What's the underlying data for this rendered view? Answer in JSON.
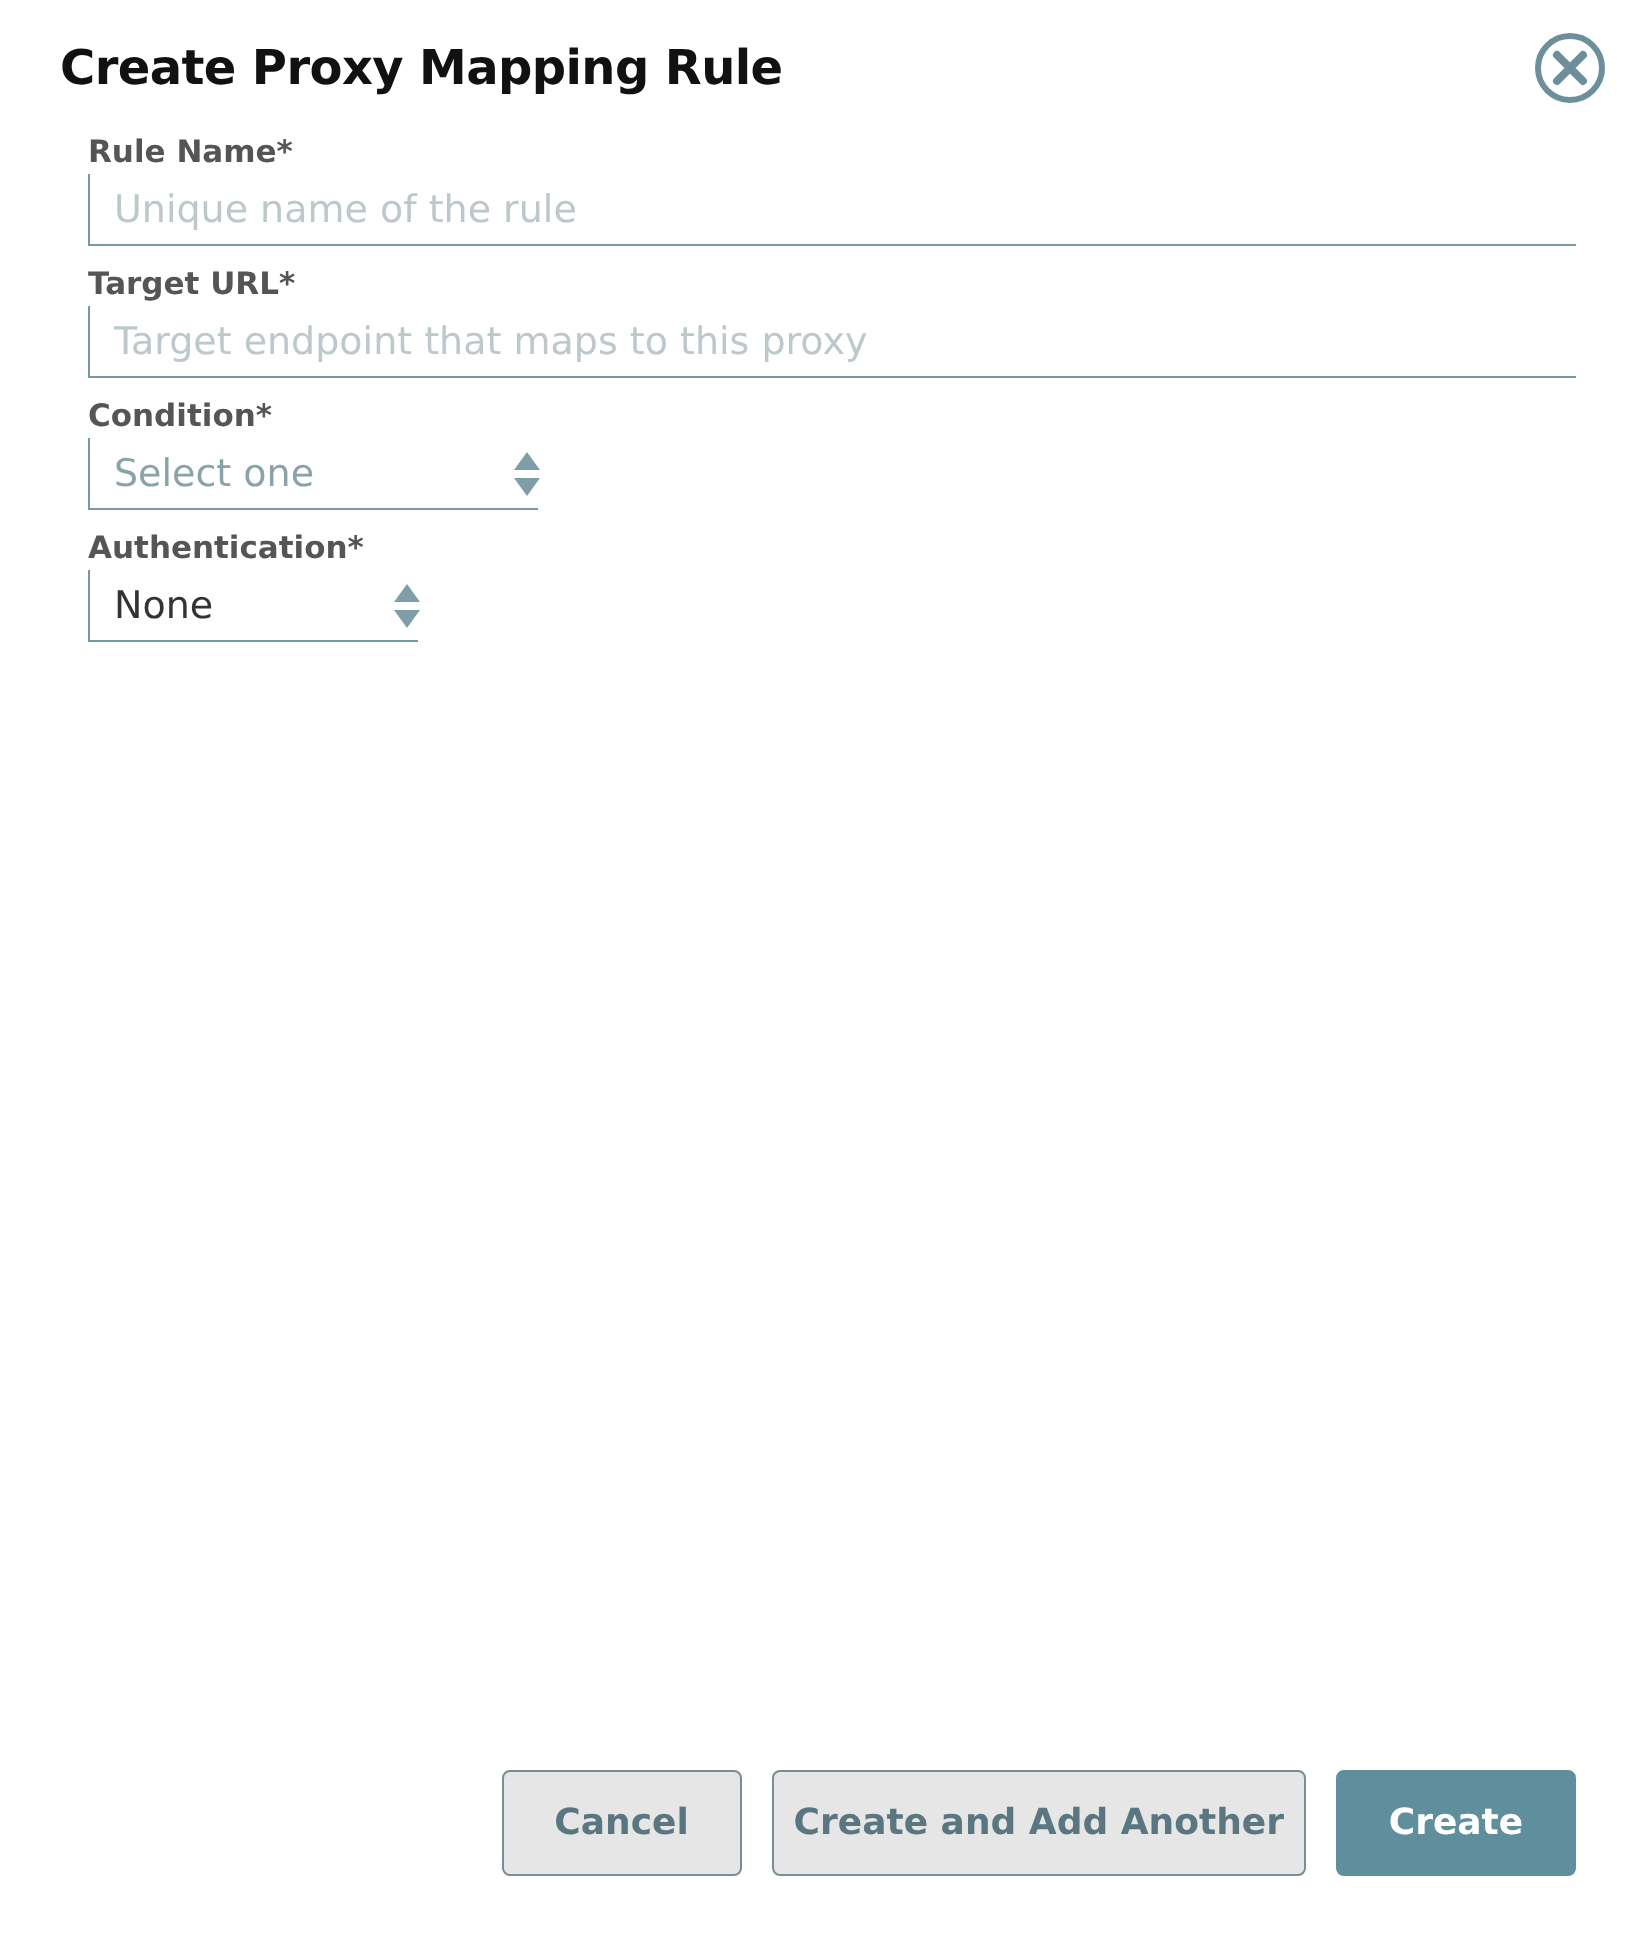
{
  "dialog": {
    "title": "Create Proxy Mapping Rule"
  },
  "fields": [
    {
      "label": "Rule Name*",
      "kind": "text",
      "placeholder": "Unique name of the rule"
    },
    {
      "label": "Target URL*",
      "kind": "text",
      "placeholder": "Target endpoint that maps to this proxy"
    },
    {
      "label": "Condition*",
      "kind": "select",
      "placeholder": "Select one"
    },
    {
      "label": "Authentication*",
      "kind": "select",
      "value": "None"
    }
  ],
  "buttons": [
    {
      "label": "Cancel",
      "kind": "secondary"
    },
    {
      "label": "Create and Add Another",
      "kind": "secondary"
    },
    {
      "label": "Create",
      "kind": "primary"
    }
  ]
}
